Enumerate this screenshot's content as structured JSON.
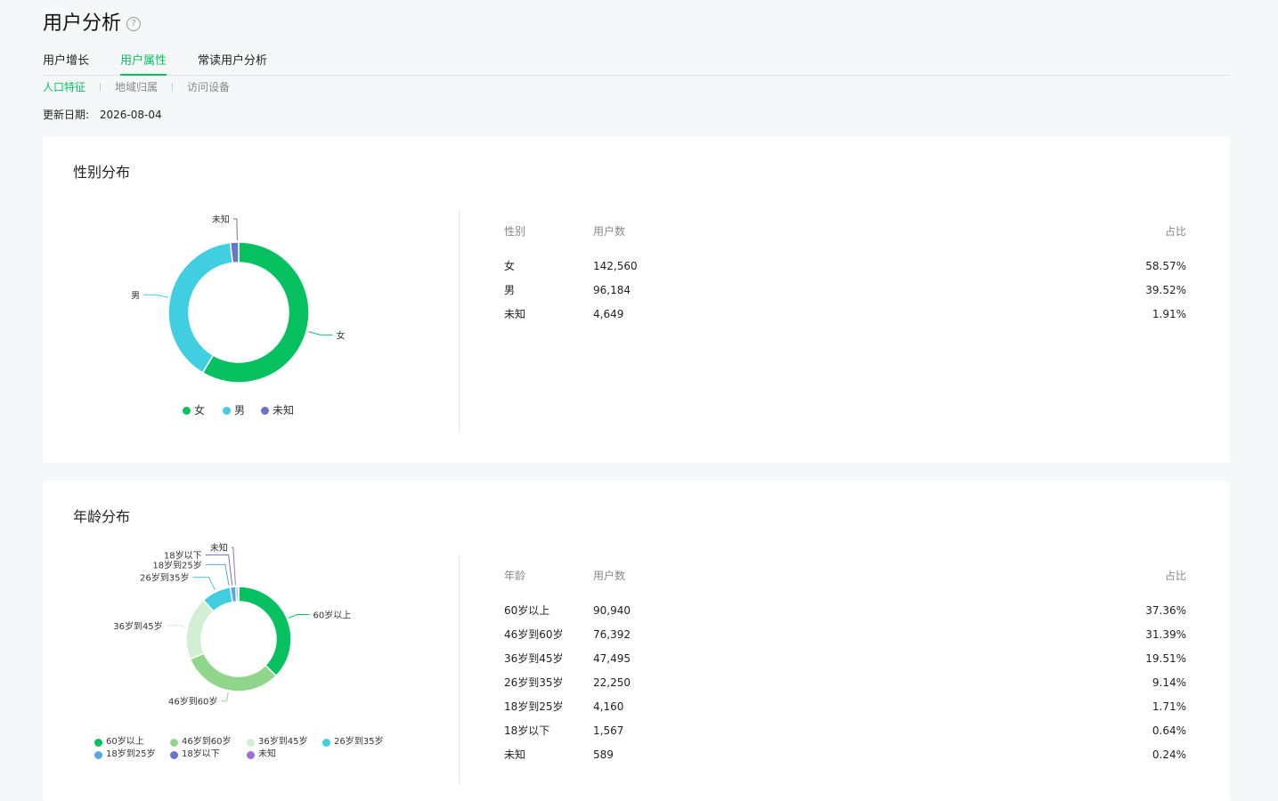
{
  "page_title": "用户分析",
  "tabs": [
    "用户增长",
    "用户属性",
    "常读用户分析"
  ],
  "subtabs": [
    "人口特征",
    "地域归属",
    "访问设备"
  ],
  "update_label": "更新日期:",
  "update_date": "2026-08-04",
  "colors": {
    "accent": "#07c160",
    "female": "#07c160",
    "male": "#40cee0",
    "unknown": "#6a74cc",
    "age_60plus": "#07c160",
    "age_46_60": "#8fd68a",
    "age_36_45": "#d3efd3",
    "age_26_35": "#40cee0",
    "age_18_25": "#5aa6e8",
    "age_under18": "#6a74cc",
    "age_unknown": "#9b6fd6"
  },
  "gender": {
    "title": "性别分布",
    "headers": [
      "性别",
      "用户数",
      "占比"
    ],
    "rows": [
      {
        "label": "女",
        "count": "142,560",
        "pct": "58.57%"
      },
      {
        "label": "男",
        "count": "96,184",
        "pct": "39.52%"
      },
      {
        "label": "未知",
        "count": "4,649",
        "pct": "1.91%"
      }
    ],
    "legend": [
      "女",
      "男",
      "未知"
    ],
    "chart_data": {
      "type": "pie",
      "donut": true,
      "categories": [
        "女",
        "男",
        "未知"
      ],
      "values": [
        58.57,
        39.52,
        1.91
      ],
      "colors": [
        "#07c160",
        "#40cee0",
        "#6a74cc"
      ],
      "legend_position": "bottom"
    }
  },
  "age": {
    "title": "年龄分布",
    "headers": [
      "年龄",
      "用户数",
      "占比"
    ],
    "rows": [
      {
        "label": "60岁以上",
        "count": "90,940",
        "pct": "37.36%"
      },
      {
        "label": "46岁到60岁",
        "count": "76,392",
        "pct": "31.39%"
      },
      {
        "label": "36岁到45岁",
        "count": "47,495",
        "pct": "19.51%"
      },
      {
        "label": "26岁到35岁",
        "count": "22,250",
        "pct": "9.14%"
      },
      {
        "label": "18岁到25岁",
        "count": "4,160",
        "pct": "1.71%"
      },
      {
        "label": "18岁以下",
        "count": "1,567",
        "pct": "0.64%"
      },
      {
        "label": "未知",
        "count": "589",
        "pct": "0.24%"
      }
    ],
    "legend": [
      "60岁以上",
      "46岁到60岁",
      "36岁到45岁",
      "26岁到35岁",
      "18岁到25岁",
      "18岁以下",
      "未知"
    ],
    "chart_data": {
      "type": "pie",
      "donut": true,
      "categories": [
        "60岁以上",
        "46岁到60岁",
        "36岁到45岁",
        "26岁到35岁",
        "18岁到25岁",
        "18岁以下",
        "未知"
      ],
      "values": [
        37.36,
        31.39,
        19.51,
        9.14,
        1.71,
        0.64,
        0.24
      ],
      "colors": [
        "#07c160",
        "#8fd68a",
        "#d3efd3",
        "#40cee0",
        "#5aa6e8",
        "#6a74cc",
        "#9b6fd6"
      ],
      "legend_position": "bottom"
    }
  }
}
